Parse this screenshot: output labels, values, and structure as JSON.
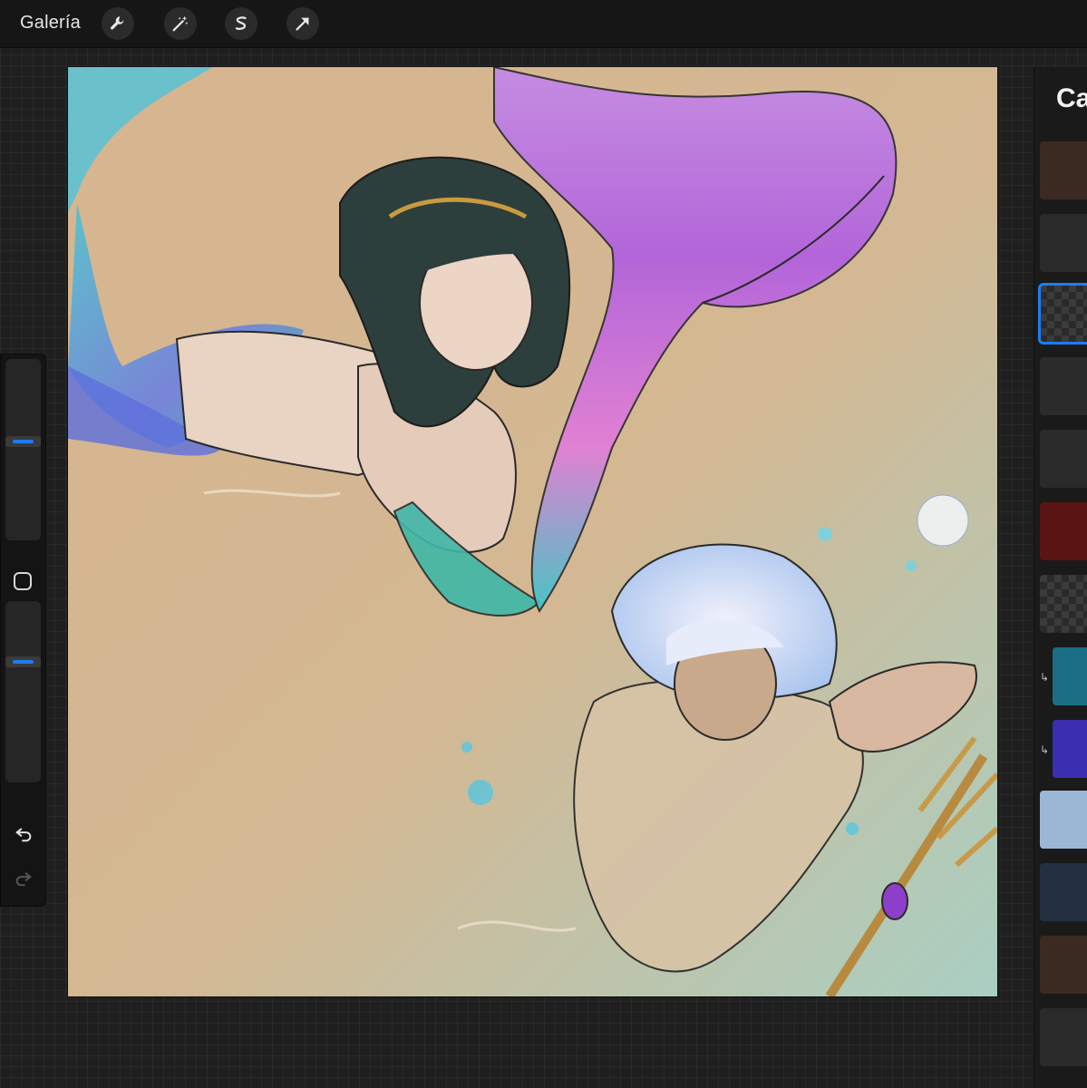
{
  "topbar": {
    "gallery_label": "Galería",
    "tools": [
      {
        "name": "wrench-icon"
      },
      {
        "name": "magic-wand-icon"
      },
      {
        "name": "selection-s-icon"
      },
      {
        "name": "transform-arrow-icon"
      }
    ]
  },
  "layers_panel": {
    "title": "Capas"
  },
  "colors": {
    "accent": "#1e7cf0",
    "toolbar": "#161616",
    "canvas_bg": "#d9b891"
  }
}
